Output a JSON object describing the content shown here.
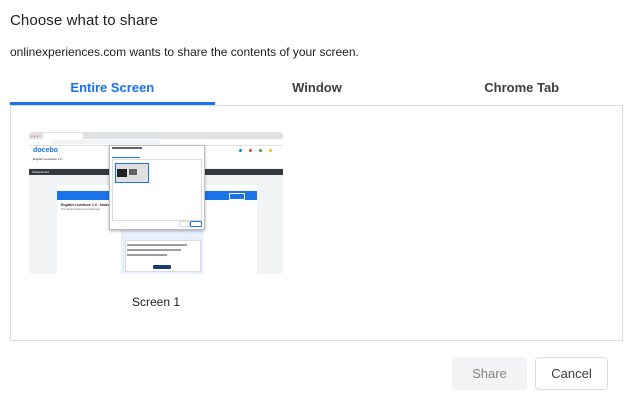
{
  "dialog": {
    "title": "Choose what to share",
    "subtitle": "onlinexperiences.com wants to share the contents of your screen."
  },
  "tabs": [
    {
      "label": "Entire Screen",
      "active": true
    },
    {
      "label": "Window",
      "active": false
    },
    {
      "label": "Chrome Tab",
      "active": false
    }
  ],
  "sources": [
    {
      "label": "Screen 1",
      "selected": false
    }
  ],
  "buttons": {
    "share_label": "Share",
    "share_disabled": true,
    "cancel_label": "Cancel"
  },
  "thumbnail": {
    "site_logo": "docebo",
    "course_heading": "English Levelsure 1.0",
    "dark_bar_text": "Virtual Event",
    "course_title": "English Levelsure 1.0 - Instructions",
    "course_subtitle": "The virtual experience environment"
  },
  "colors": {
    "accent": "#1a73e8",
    "border": "#dadce0",
    "text": "#202124"
  }
}
